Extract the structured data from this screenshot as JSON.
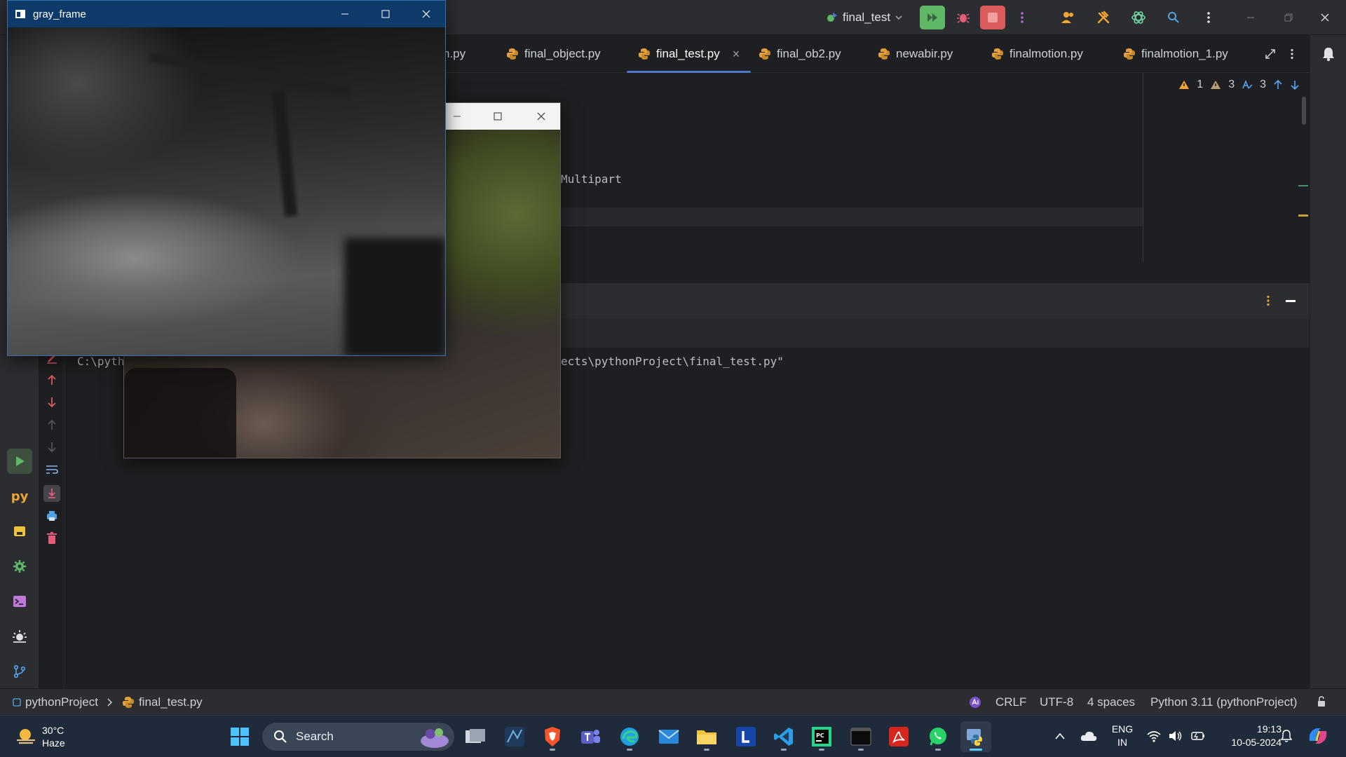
{
  "toolbar": {
    "run_config": "final_test",
    "colors": {
      "run_green": "#5fb865",
      "stop_red": "#db5c5c",
      "debug_red": "#e55b7a"
    }
  },
  "tabs": [
    {
      "label": "n.py",
      "active": false,
      "closable": false
    },
    {
      "label": "final_object.py",
      "active": false,
      "closable": false
    },
    {
      "label": "final_test.py",
      "active": true,
      "closable": true
    },
    {
      "label": "final_ob2.py",
      "active": false,
      "closable": false
    },
    {
      "label": "newabir.py",
      "active": false,
      "closable": false
    },
    {
      "label": "finalmotion.py",
      "active": false,
      "closable": false
    },
    {
      "label": "finalmotion_1.py",
      "active": false,
      "closable": false
    }
  ],
  "tab_close_glyph": "×",
  "editor": {
    "visible_code": "Multipart",
    "inspections": {
      "errors": "1",
      "warnings": "3",
      "typos": "3"
    }
  },
  "console": {
    "line_left": "C:\\pyth",
    "line_right": "ects\\pythonProject\\final_test.py\""
  },
  "status_bar": {
    "project": "pythonProject",
    "file": "final_test.py",
    "line_ending": "CRLF",
    "encoding": "UTF-8",
    "indent": "4 spaces",
    "interpreter": "Python 3.11 (pythonProject)"
  },
  "windows": {
    "gray_frame_title": "gray_frame"
  },
  "taskbar": {
    "weather_temp": "30°C",
    "weather_desc": "Haze",
    "search_placeholder": "Search",
    "lang_line1": "ENG",
    "lang_line2": "IN",
    "time": "19:13",
    "date": "10-05-2024"
  },
  "icons": [
    "python-file-icon",
    "run-icon",
    "debug-icon",
    "stop-icon",
    "search-icon",
    "gear-icon",
    "bell-icon",
    "windows-start-icon",
    "wifi-icon",
    "volume-icon",
    "battery-icon"
  ]
}
